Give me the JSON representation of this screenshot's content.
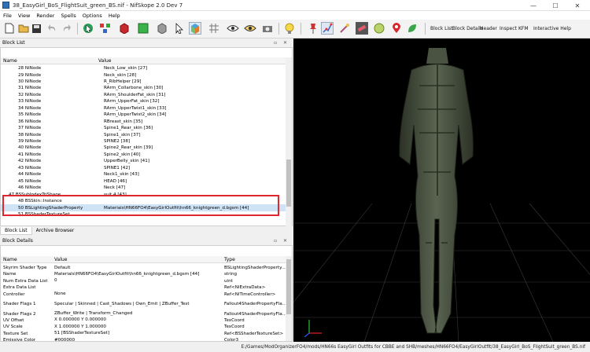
{
  "window": {
    "title": "38_EasyGirl_BoS_FlightSuit_green_BS.nif - NifSkope 2.0 Dev 7",
    "minimize": "—",
    "maximize": "☐",
    "close": "✕"
  },
  "menu": [
    "File",
    "View",
    "Render",
    "Spells",
    "Options",
    "Help"
  ],
  "toolbar": {
    "text_buttons": [
      "Block List",
      "Block Details",
      "Header",
      "Inspect",
      "KFM",
      "Interactive Help"
    ]
  },
  "block_list": {
    "title": "Block List",
    "columns": [
      "Name",
      "Value"
    ],
    "rows": [
      {
        "name": "28 NiNode",
        "value": "Neck_Low_skin [27]"
      },
      {
        "name": "29 NiNode",
        "value": "Neck_skin [28]"
      },
      {
        "name": "30 NiNode",
        "value": "R_RibHelper [29]"
      },
      {
        "name": "31 NiNode",
        "value": "RArm_Collarbone_skin [30]"
      },
      {
        "name": "32 NiNode",
        "value": "RArm_ShoulderFat_skin [31]"
      },
      {
        "name": "33 NiNode",
        "value": "RArm_UpperFat_skin [32]"
      },
      {
        "name": "34 NiNode",
        "value": "RArm_UpperTwist1_skin [33]"
      },
      {
        "name": "35 NiNode",
        "value": "RArm_UpperTwist2_skin [34]"
      },
      {
        "name": "36 NiNode",
        "value": "RBreast_skin [35]"
      },
      {
        "name": "37 NiNode",
        "value": "Spine1_Rear_skin [36]"
      },
      {
        "name": "38 NiNode",
        "value": "Spine1_skin [37]"
      },
      {
        "name": "39 NiNode",
        "value": "SPINE2 [38]"
      },
      {
        "name": "40 NiNode",
        "value": "Spine2_Rear_skin [39]"
      },
      {
        "name": "41 NiNode",
        "value": "Spine2_skin [40]"
      },
      {
        "name": "42 NiNode",
        "value": "UpperBelly_skin [41]"
      },
      {
        "name": "43 NiNode",
        "value": "SPINE1 [42]"
      },
      {
        "name": "44 NiNode",
        "value": "Neck1_skin [43]"
      },
      {
        "name": "45 NiNode",
        "value": "HEAD [46]"
      },
      {
        "name": "46 NiNode",
        "value": "Neck [47]"
      },
      {
        "name": "47 BSSubIndexTriShape",
        "value": "suit 4 [43]"
      },
      {
        "name": "48 BSSkin::Instance",
        "value": ""
      },
      {
        "name": "50 BSLightingShaderProperty",
        "value": "Materials\\HN66FO4\\EasyGirlOutfit\\hn66_knightgreen_d.bgsm [44]"
      },
      {
        "name": "51 BSShaderTextureSet",
        "value": ""
      }
    ]
  },
  "tabs": [
    "Block List",
    "Archive Browser"
  ],
  "block_details": {
    "title": "Block Details",
    "columns": [
      "Name",
      "Value",
      "Type"
    ],
    "rows": [
      {
        "name": "Skyrim Shader Type",
        "value": "Default",
        "type": "BSLightingShaderProperty..."
      },
      {
        "name": "Name",
        "value": "Materials\\HN66FO4\\EasyGirlOutfit\\hn66_knightgreen_d.bgsm [44]",
        "type": "string"
      },
      {
        "name": "Num Extra Data List",
        "value": "0",
        "type": "uint"
      },
      {
        "name": "Extra Data List",
        "value": "",
        "type": "Ref<NiExtraData>"
      },
      {
        "name": "Controller",
        "value": "None",
        "type": "Ref<NiTimeController>"
      },
      {
        "name": "Shader Flags 1",
        "value": "Specular | Skinned | Cast_Shadows | Own_Emit | ZBuffer_Test",
        "type": "Fallout4ShaderPropertyFla..."
      },
      {
        "name": "Shader Flags 2",
        "value": "ZBuffer_Write | Transform_Changed",
        "type": "Fallout4ShaderPropertyFla..."
      },
      {
        "name": "UV Offset",
        "value": "X 0.000000 Y 0.000000",
        "type": "TexCoord"
      },
      {
        "name": "UV Scale",
        "value": "X 1.000000 Y 1.000000",
        "type": "TexCoord"
      },
      {
        "name": "Texture Set",
        "value": "51 [BSShaderTextureSet]",
        "type": "Ref<BSShaderTextureSet>"
      },
      {
        "name": "Emissive Color",
        "value": "#000000",
        "type": "Color3"
      }
    ]
  },
  "status_path": "E:/Games/ModOrganizerFO4/mods/HN66s EasyGirl Outfits for CBBE and SHB/meshes/HN66FO4/EasyGirlOutfit/38_EasyGirl_BoS_FlightSuit_green_BS.nif",
  "colors": {
    "highlight": "#e0262e",
    "viewport_bg": "#000000",
    "selection": "#cfe3f7"
  }
}
